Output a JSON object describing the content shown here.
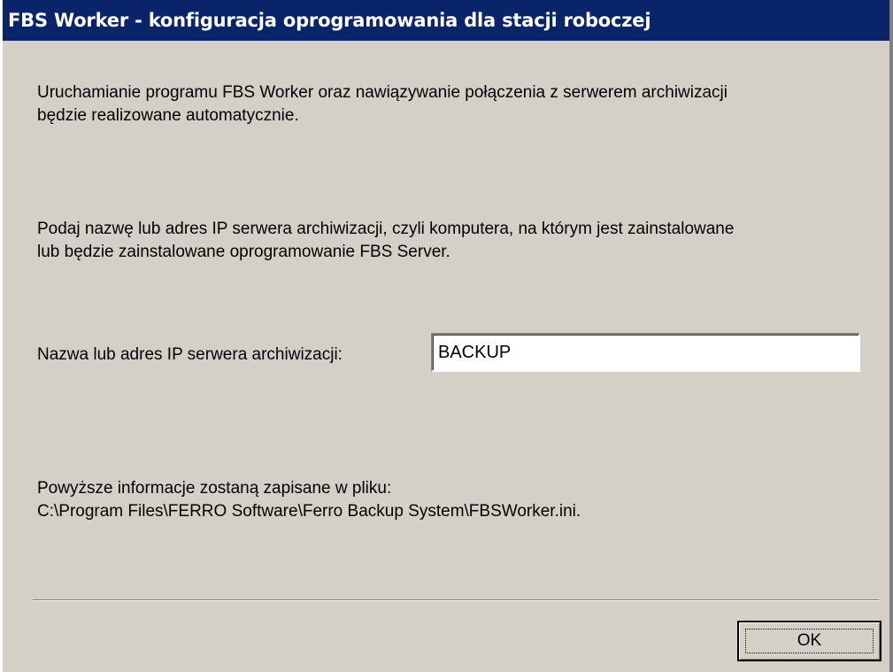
{
  "window": {
    "title": "FBS Worker - konfiguracja oprogramowania dla stacji roboczej"
  },
  "content": {
    "paragraph_startup": "Uruchamianie programu FBS Worker oraz nawiązywanie połączenia z serwerem archiwizacji\nbędzie realizowane automatycznie.",
    "paragraph_instruction": "Podaj nazwę lub adres IP serwera archiwizacji, czyli komputera, na którym jest zainstalowane\nlub będzie zainstalowane oprogramowanie FBS Server.",
    "server_field": {
      "label": "Nazwa lub adres IP serwera archiwizacji:",
      "value": "BACKUP"
    },
    "paragraph_save_info": "Powyższe informacje zostaną zapisane w pliku:\nC:\\Program Files\\FERRO Software\\Ferro Backup System\\FBSWorker.ini."
  },
  "buttons": {
    "ok_label": "OK"
  },
  "colors": {
    "title_bar": "#0a246a",
    "dialog_background": "#d4d0c8",
    "title_text": "#ffffff"
  }
}
